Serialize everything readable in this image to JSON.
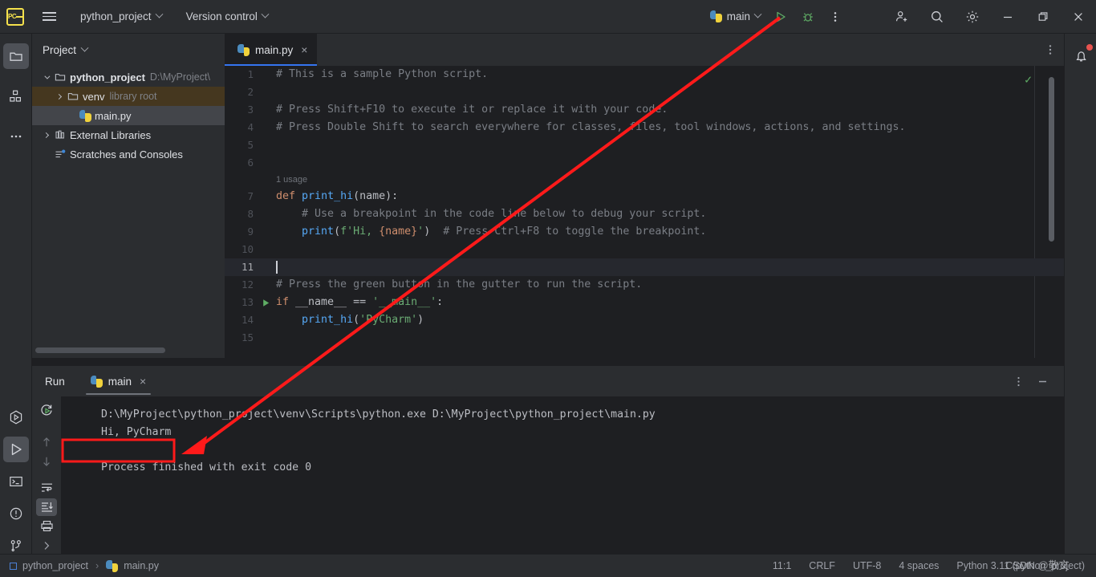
{
  "titlebar": {
    "logo": "pycharm-logo",
    "menu_icon": "hamburger-icon",
    "project_name": "python_project",
    "version_control": "Version control",
    "run_config": "main",
    "icons": {
      "run": "run-icon",
      "debug": "debug-icon",
      "more": "more-vertical-icon",
      "add_user": "add-user-icon",
      "search": "search-icon",
      "settings": "gear-icon",
      "minimize": "minimize-icon",
      "maximize": "maximize-icon",
      "close": "close-icon"
    }
  },
  "leftbar": {
    "items": [
      {
        "name": "project-icon",
        "selected": true
      },
      {
        "name": "structure-icon",
        "selected": false
      },
      {
        "name": "more-tool-windows-icon",
        "selected": false
      }
    ],
    "bottom_items": [
      {
        "name": "run-with-coverage-icon",
        "selected": false
      },
      {
        "name": "run-tool-window-icon",
        "selected": true
      },
      {
        "name": "terminal-icon",
        "selected": false
      },
      {
        "name": "problems-icon",
        "selected": false
      },
      {
        "name": "version-control-icon",
        "selected": false
      }
    ]
  },
  "project_panel": {
    "header": "Project",
    "tree": [
      {
        "label": "python_project",
        "suffix": "D:\\MyProject\\",
        "icon": "folder-icon",
        "indent": 0,
        "arrow": "down",
        "bold": true,
        "state": "normal"
      },
      {
        "label": "venv",
        "suffix": "library root",
        "icon": "folder-icon",
        "indent": 1,
        "arrow": "right",
        "bold": false,
        "state": "venv"
      },
      {
        "label": "main.py",
        "suffix": "",
        "icon": "python-file-icon",
        "indent": 2,
        "arrow": "none",
        "bold": false,
        "state": "selected"
      },
      {
        "label": "External Libraries",
        "suffix": "",
        "icon": "library-icon",
        "indent": 0,
        "arrow": "right",
        "bold": false,
        "state": "normal"
      },
      {
        "label": "Scratches and Consoles",
        "suffix": "",
        "icon": "scratches-icon",
        "indent": 0,
        "arrow": "none",
        "bold": false,
        "state": "normal"
      }
    ]
  },
  "editor": {
    "tab": {
      "label": "main.py",
      "icon": "python-file-icon",
      "close": "×"
    },
    "options_icon": "more-vertical-icon",
    "inspection_status": "✓",
    "usage_hint": "1 usage",
    "lines": [
      {
        "n": "1",
        "tokens": [
          {
            "t": "cmt",
            "v": "# This is a sample Python script."
          }
        ]
      },
      {
        "n": "2",
        "tokens": []
      },
      {
        "n": "3",
        "tokens": [
          {
            "t": "cmt",
            "v": "# Press Shift+F10 to execute it or replace it with your code."
          }
        ]
      },
      {
        "n": "4",
        "tokens": [
          {
            "t": "cmt",
            "v": "# Press Double Shift to search everywhere for classes, files, tool windows, actions, and settings."
          }
        ]
      },
      {
        "n": "5",
        "tokens": []
      },
      {
        "n": "6",
        "tokens": []
      },
      {
        "n": "7",
        "tokens": [
          {
            "t": "kw",
            "v": "def"
          },
          {
            "t": "pln",
            "v": " "
          },
          {
            "t": "fn",
            "v": "print_hi"
          },
          {
            "t": "pln",
            "v": "(name):"
          }
        ]
      },
      {
        "n": "8",
        "tokens": [
          {
            "t": "cmt",
            "v": "    # Use a breakpoint in the code line below to debug your script."
          }
        ]
      },
      {
        "n": "9",
        "tokens": [
          {
            "t": "pln",
            "v": "    "
          },
          {
            "t": "fn",
            "v": "print"
          },
          {
            "t": "pln",
            "v": "("
          },
          {
            "t": "str",
            "v": "f'Hi, "
          },
          {
            "t": "brc",
            "v": "{name}"
          },
          {
            "t": "str",
            "v": "'"
          },
          {
            "t": "pln",
            "v": ")  "
          },
          {
            "t": "cmt",
            "v": "# Press Ctrl+F8 to toggle the breakpoint."
          }
        ]
      },
      {
        "n": "10",
        "tokens": []
      },
      {
        "n": "11",
        "tokens": [],
        "caret": true
      },
      {
        "n": "12",
        "tokens": [
          {
            "t": "cmt",
            "v": "# Press the green button in the gutter to run the script."
          }
        ]
      },
      {
        "n": "13",
        "tokens": [
          {
            "t": "kw",
            "v": "if"
          },
          {
            "t": "pln",
            "v": " __name__ == "
          },
          {
            "t": "str",
            "v": "'__main__'"
          },
          {
            "t": "pln",
            "v": ":"
          }
        ],
        "gutter_run": true
      },
      {
        "n": "14",
        "tokens": [
          {
            "t": "pln",
            "v": "    "
          },
          {
            "t": "fn",
            "v": "print_hi"
          },
          {
            "t": "pln",
            "v": "("
          },
          {
            "t": "str",
            "v": "'PyCharm'"
          },
          {
            "t": "pln",
            "v": ")"
          }
        ]
      },
      {
        "n": "15",
        "tokens": []
      }
    ]
  },
  "run_panel": {
    "title": "Run",
    "tab": {
      "label": "main",
      "icon": "python-file-icon",
      "close": "×"
    },
    "toolbar": [
      {
        "name": "rerun-icon",
        "selected": false
      },
      {
        "name": "arrow-up-icon",
        "selected": false
      },
      {
        "name": "arrow-down-icon",
        "selected": false
      },
      {
        "name": "soft-wrap-icon",
        "selected": false
      },
      {
        "name": "scroll-to-end-icon",
        "selected": true
      },
      {
        "name": "print-icon",
        "selected": false
      },
      {
        "name": "expand-icon",
        "selected": false
      }
    ],
    "header_icons": {
      "more": "more-vertical-icon",
      "minimize": "minimize-icon"
    },
    "left_controls": [
      {
        "name": "rerun-run-icon"
      },
      {
        "name": "stop-icon"
      },
      {
        "name": "more-vertical-icon"
      }
    ],
    "console": {
      "command": "D:\\MyProject\\python_project\\venv\\Scripts\\python.exe D:\\MyProject\\python_project\\main.py",
      "output": "Hi, PyCharm",
      "exit_message": "Process finished with exit code 0"
    }
  },
  "statusbar": {
    "breadcrumb_project": "python_project",
    "breadcrumb_sep": "›",
    "breadcrumb_file": "main.py",
    "caret_position": "11:1",
    "line_separator": "CRLF",
    "encoding": "UTF-8",
    "indent": "4 spaces",
    "interpreter": "Python 3.11 (python_project)"
  },
  "watermark": {
    "text": "CSDN @敬文"
  },
  "annotations": {
    "arrow_color": "#ff1a1a",
    "highlight_box": {
      "label": "Hi, PyCharm"
    }
  },
  "colors": {
    "accent_blue": "#3574f0",
    "run_green": "#5fad65",
    "panel_bg": "#2b2d30",
    "editor_bg": "#1e1f22",
    "annotation_red": "#ff1a1a",
    "venv_highlight": "#45371f"
  }
}
